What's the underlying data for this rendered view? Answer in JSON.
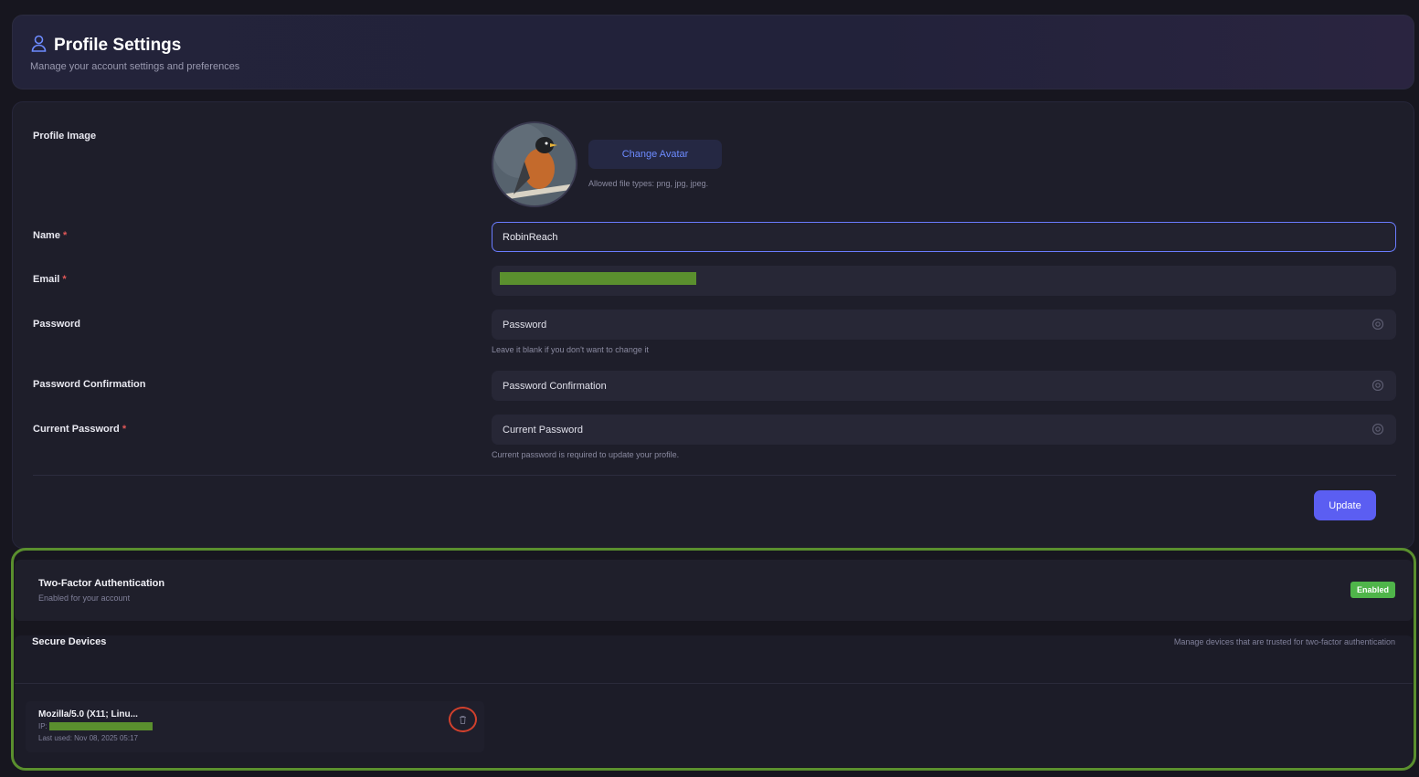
{
  "header": {
    "title": "Profile Settings",
    "subtitle": "Manage your account settings and preferences",
    "icon": "user-icon"
  },
  "form": {
    "profile_image_label": "Profile Image",
    "change_avatar_label": "Change Avatar",
    "allowed_types": "Allowed file types: png, jpg, jpeg.",
    "name_label": "Name",
    "name_value": "RobinReach",
    "email_label": "Email",
    "password_label": "Password",
    "password_placeholder": "Password",
    "password_hint": "Leave it blank if you don't want to change it",
    "password_confirmation_label": "Password Confirmation",
    "password_confirmation_placeholder": "Password Confirmation",
    "current_password_label": "Current Password",
    "current_password_placeholder": "Current Password",
    "current_password_hint": "Current password is required to update your profile.",
    "required_mark": "*",
    "update_label": "Update"
  },
  "two_factor": {
    "title": "Two-Factor Authentication",
    "subtitle": "Enabled for your account",
    "badge": "Enabled",
    "badge_color": "#4fb54a"
  },
  "secure_devices": {
    "title": "Secure Devices",
    "description": "Manage devices that are trusted for two-factor authentication",
    "devices": [
      {
        "name": "Mozilla/5.0 (X11; Linu...",
        "ip_label": "IP:",
        "last_used": "Last used: Nov 08, 2025 05:17"
      }
    ]
  },
  "colors": {
    "accent": "#5b5ef2",
    "highlight": "#5a8f2e",
    "danger": "#d1402c"
  }
}
